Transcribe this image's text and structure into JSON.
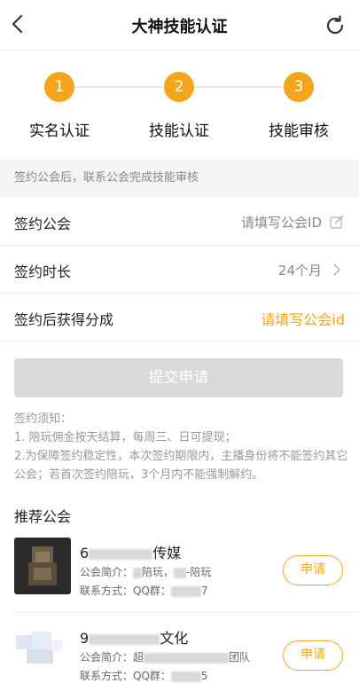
{
  "header": {
    "title": "大神技能认证",
    "back_icon": "back-arrow-icon",
    "refresh_icon": "refresh-icon"
  },
  "steps": [
    {
      "number": "1",
      "label": "实名认证"
    },
    {
      "number": "2",
      "label": "技能认证"
    },
    {
      "number": "3",
      "label": "技能审核"
    }
  ],
  "note": "签约公会后，联系公会完成技能审核",
  "form": {
    "guild": {
      "label": "签约公会",
      "placeholder": "请填写公会ID",
      "icon": "edit-icon"
    },
    "duration": {
      "label": "签约时长",
      "value": "24个月",
      "icon": "chevron-right-icon"
    },
    "share": {
      "label": "签约后获得分成",
      "value": "请填写公会id"
    }
  },
  "submit_label": "提交申请",
  "notice": {
    "title": "签约须知：",
    "line1": "1. 陪玩佣金按天结算，每周三、日可提现；",
    "line2": "2.为保障签约稳定性，本次签约期限内，主播身份将不能签约其它公会；若首次签约陪玩，3个月内不能强制解约。"
  },
  "recommend_title": "推荐公会",
  "guilds": [
    {
      "name_prefix": "6",
      "name_suffix": "传媒",
      "desc_label": "公会简介：",
      "desc_mid": "陪玩，",
      "desc_tail": "-陪玩",
      "contact_label": "联系方式：QQ群：",
      "contact_tail": "7",
      "apply": "申请"
    },
    {
      "name_prefix": "9",
      "name_suffix": "文化",
      "desc_label": "公会简介：超",
      "desc_tail": "团队",
      "contact_label": "联系方式：QQ群：",
      "contact_tail": "5",
      "apply": "申请"
    }
  ],
  "colors": {
    "accent": "#f5a51c",
    "disabled": "#d9d9d9"
  }
}
